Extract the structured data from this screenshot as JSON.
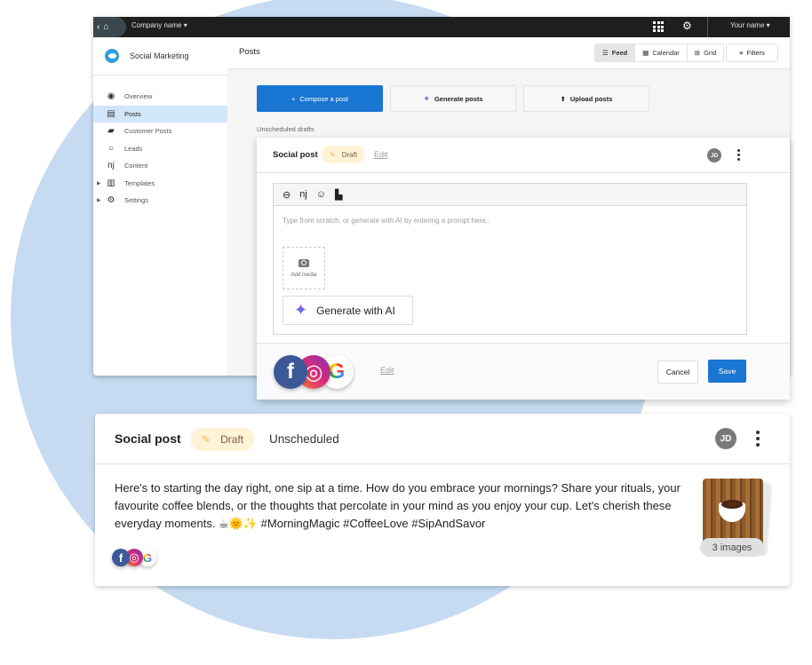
{
  "colors": {
    "accent": "#1976d2",
    "active_nav": "#d2e6f9",
    "draft_bg": "#fff3d6",
    "background_shape": "#c6dbf1"
  },
  "topbar": {
    "company": "Company name",
    "user": "Your name",
    "home_icon": "home-icon",
    "back_icon": "chevron-left-icon",
    "apps_icon": "apps-grid-icon",
    "settings_icon": "gear-icon"
  },
  "sidebar": {
    "title": "Social Marketing",
    "items": [
      {
        "label": "Overview",
        "icon": "compass-icon",
        "active": false
      },
      {
        "label": "Posts",
        "icon": "post-icon",
        "active": true
      },
      {
        "label": "Customer Posts",
        "icon": "chat-icon",
        "active": false
      },
      {
        "label": "Leads",
        "icon": "target-icon",
        "active": false
      },
      {
        "label": "Content",
        "icon": "rss-icon",
        "active": false
      },
      {
        "label": "Templates",
        "icon": "chart-icon",
        "active": false,
        "expandable": true
      },
      {
        "label": "Settings",
        "icon": "gear-icon",
        "active": false,
        "expandable": true
      }
    ]
  },
  "header": {
    "title": "Posts",
    "views": [
      {
        "label": "Feed",
        "active": true
      },
      {
        "label": "Calendar",
        "active": false
      },
      {
        "label": "Grid",
        "active": false
      }
    ],
    "filters": "Filters"
  },
  "actions": {
    "compose": "Compose a post",
    "generate": "Generate posts",
    "upload": "Upload posts"
  },
  "section_label": "Unscheduled drafts",
  "compose_card": {
    "title": "Social post",
    "status": "Draft",
    "edit": "Edit",
    "avatar": "JD",
    "placeholder": "Type from scratch, or generate with AI by entering a prompt here..",
    "add_media": "Add media",
    "generate_ai": "Generate with AI",
    "footer_edit": "Edit",
    "cancel": "Cancel",
    "save": "Save",
    "toolbar_icons": [
      "link-icon",
      "rss-icon",
      "emoji-icon",
      "layout-icon"
    ],
    "networks": [
      "Facebook",
      "Instagram",
      "Google"
    ]
  },
  "post_card": {
    "title": "Social post",
    "status": "Draft",
    "schedule": "Unscheduled",
    "avatar": "JD",
    "body": "Here's to starting the day right, one sip at a time. How do you embrace your mornings? Share your rituals, your favourite coffee blends, or the thoughts that percolate in your mind as you enjoy your cup. Let's cherish these everyday moments. ☕🌞✨ #MorningMagic #CoffeeLove #SipAndSavor",
    "images_count": "3 images",
    "networks": [
      "Facebook",
      "Instagram",
      "Google"
    ]
  }
}
